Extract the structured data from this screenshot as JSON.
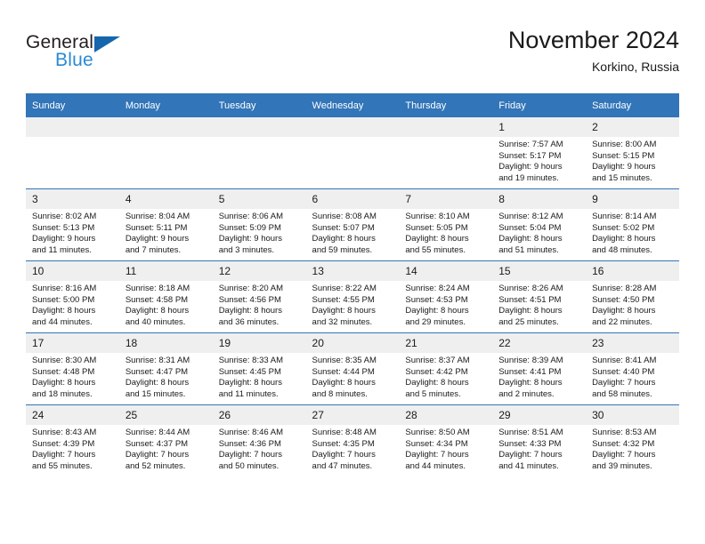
{
  "brand": {
    "name_top": "General",
    "name_bottom": "Blue"
  },
  "header": {
    "title": "November 2024",
    "subtitle": "Korkino, Russia"
  },
  "colors": {
    "header_blue": "#3275b8",
    "logo_blue": "#2a8ad4",
    "logo_triangle": "#1666ae",
    "daynum_band": "#efefef",
    "text": "#1a1a1a"
  },
  "weekday_headers": [
    "Sunday",
    "Monday",
    "Tuesday",
    "Wednesday",
    "Thursday",
    "Friday",
    "Saturday"
  ],
  "weeks": [
    [
      {
        "day": "",
        "empty": true
      },
      {
        "day": "",
        "empty": true
      },
      {
        "day": "",
        "empty": true
      },
      {
        "day": "",
        "empty": true
      },
      {
        "day": "",
        "empty": true
      },
      {
        "day": "1",
        "sunrise": "Sunrise: 7:57 AM",
        "sunset": "Sunset: 5:17 PM",
        "daylight_1": "Daylight: 9 hours",
        "daylight_2": "and 19 minutes."
      },
      {
        "day": "2",
        "sunrise": "Sunrise: 8:00 AM",
        "sunset": "Sunset: 5:15 PM",
        "daylight_1": "Daylight: 9 hours",
        "daylight_2": "and 15 minutes."
      }
    ],
    [
      {
        "day": "3",
        "sunrise": "Sunrise: 8:02 AM",
        "sunset": "Sunset: 5:13 PM",
        "daylight_1": "Daylight: 9 hours",
        "daylight_2": "and 11 minutes."
      },
      {
        "day": "4",
        "sunrise": "Sunrise: 8:04 AM",
        "sunset": "Sunset: 5:11 PM",
        "daylight_1": "Daylight: 9 hours",
        "daylight_2": "and 7 minutes."
      },
      {
        "day": "5",
        "sunrise": "Sunrise: 8:06 AM",
        "sunset": "Sunset: 5:09 PM",
        "daylight_1": "Daylight: 9 hours",
        "daylight_2": "and 3 minutes."
      },
      {
        "day": "6",
        "sunrise": "Sunrise: 8:08 AM",
        "sunset": "Sunset: 5:07 PM",
        "daylight_1": "Daylight: 8 hours",
        "daylight_2": "and 59 minutes."
      },
      {
        "day": "7",
        "sunrise": "Sunrise: 8:10 AM",
        "sunset": "Sunset: 5:05 PM",
        "daylight_1": "Daylight: 8 hours",
        "daylight_2": "and 55 minutes."
      },
      {
        "day": "8",
        "sunrise": "Sunrise: 8:12 AM",
        "sunset": "Sunset: 5:04 PM",
        "daylight_1": "Daylight: 8 hours",
        "daylight_2": "and 51 minutes."
      },
      {
        "day": "9",
        "sunrise": "Sunrise: 8:14 AM",
        "sunset": "Sunset: 5:02 PM",
        "daylight_1": "Daylight: 8 hours",
        "daylight_2": "and 48 minutes."
      }
    ],
    [
      {
        "day": "10",
        "sunrise": "Sunrise: 8:16 AM",
        "sunset": "Sunset: 5:00 PM",
        "daylight_1": "Daylight: 8 hours",
        "daylight_2": "and 44 minutes."
      },
      {
        "day": "11",
        "sunrise": "Sunrise: 8:18 AM",
        "sunset": "Sunset: 4:58 PM",
        "daylight_1": "Daylight: 8 hours",
        "daylight_2": "and 40 minutes."
      },
      {
        "day": "12",
        "sunrise": "Sunrise: 8:20 AM",
        "sunset": "Sunset: 4:56 PM",
        "daylight_1": "Daylight: 8 hours",
        "daylight_2": "and 36 minutes."
      },
      {
        "day": "13",
        "sunrise": "Sunrise: 8:22 AM",
        "sunset": "Sunset: 4:55 PM",
        "daylight_1": "Daylight: 8 hours",
        "daylight_2": "and 32 minutes."
      },
      {
        "day": "14",
        "sunrise": "Sunrise: 8:24 AM",
        "sunset": "Sunset: 4:53 PM",
        "daylight_1": "Daylight: 8 hours",
        "daylight_2": "and 29 minutes."
      },
      {
        "day": "15",
        "sunrise": "Sunrise: 8:26 AM",
        "sunset": "Sunset: 4:51 PM",
        "daylight_1": "Daylight: 8 hours",
        "daylight_2": "and 25 minutes."
      },
      {
        "day": "16",
        "sunrise": "Sunrise: 8:28 AM",
        "sunset": "Sunset: 4:50 PM",
        "daylight_1": "Daylight: 8 hours",
        "daylight_2": "and 22 minutes."
      }
    ],
    [
      {
        "day": "17",
        "sunrise": "Sunrise: 8:30 AM",
        "sunset": "Sunset: 4:48 PM",
        "daylight_1": "Daylight: 8 hours",
        "daylight_2": "and 18 minutes."
      },
      {
        "day": "18",
        "sunrise": "Sunrise: 8:31 AM",
        "sunset": "Sunset: 4:47 PM",
        "daylight_1": "Daylight: 8 hours",
        "daylight_2": "and 15 minutes."
      },
      {
        "day": "19",
        "sunrise": "Sunrise: 8:33 AM",
        "sunset": "Sunset: 4:45 PM",
        "daylight_1": "Daylight: 8 hours",
        "daylight_2": "and 11 minutes."
      },
      {
        "day": "20",
        "sunrise": "Sunrise: 8:35 AM",
        "sunset": "Sunset: 4:44 PM",
        "daylight_1": "Daylight: 8 hours",
        "daylight_2": "and 8 minutes."
      },
      {
        "day": "21",
        "sunrise": "Sunrise: 8:37 AM",
        "sunset": "Sunset: 4:42 PM",
        "daylight_1": "Daylight: 8 hours",
        "daylight_2": "and 5 minutes."
      },
      {
        "day": "22",
        "sunrise": "Sunrise: 8:39 AM",
        "sunset": "Sunset: 4:41 PM",
        "daylight_1": "Daylight: 8 hours",
        "daylight_2": "and 2 minutes."
      },
      {
        "day": "23",
        "sunrise": "Sunrise: 8:41 AM",
        "sunset": "Sunset: 4:40 PM",
        "daylight_1": "Daylight: 7 hours",
        "daylight_2": "and 58 minutes."
      }
    ],
    [
      {
        "day": "24",
        "sunrise": "Sunrise: 8:43 AM",
        "sunset": "Sunset: 4:39 PM",
        "daylight_1": "Daylight: 7 hours",
        "daylight_2": "and 55 minutes."
      },
      {
        "day": "25",
        "sunrise": "Sunrise: 8:44 AM",
        "sunset": "Sunset: 4:37 PM",
        "daylight_1": "Daylight: 7 hours",
        "daylight_2": "and 52 minutes."
      },
      {
        "day": "26",
        "sunrise": "Sunrise: 8:46 AM",
        "sunset": "Sunset: 4:36 PM",
        "daylight_1": "Daylight: 7 hours",
        "daylight_2": "and 50 minutes."
      },
      {
        "day": "27",
        "sunrise": "Sunrise: 8:48 AM",
        "sunset": "Sunset: 4:35 PM",
        "daylight_1": "Daylight: 7 hours",
        "daylight_2": "and 47 minutes."
      },
      {
        "day": "28",
        "sunrise": "Sunrise: 8:50 AM",
        "sunset": "Sunset: 4:34 PM",
        "daylight_1": "Daylight: 7 hours",
        "daylight_2": "and 44 minutes."
      },
      {
        "day": "29",
        "sunrise": "Sunrise: 8:51 AM",
        "sunset": "Sunset: 4:33 PM",
        "daylight_1": "Daylight: 7 hours",
        "daylight_2": "and 41 minutes."
      },
      {
        "day": "30",
        "sunrise": "Sunrise: 8:53 AM",
        "sunset": "Sunset: 4:32 PM",
        "daylight_1": "Daylight: 7 hours",
        "daylight_2": "and 39 minutes."
      }
    ]
  ]
}
